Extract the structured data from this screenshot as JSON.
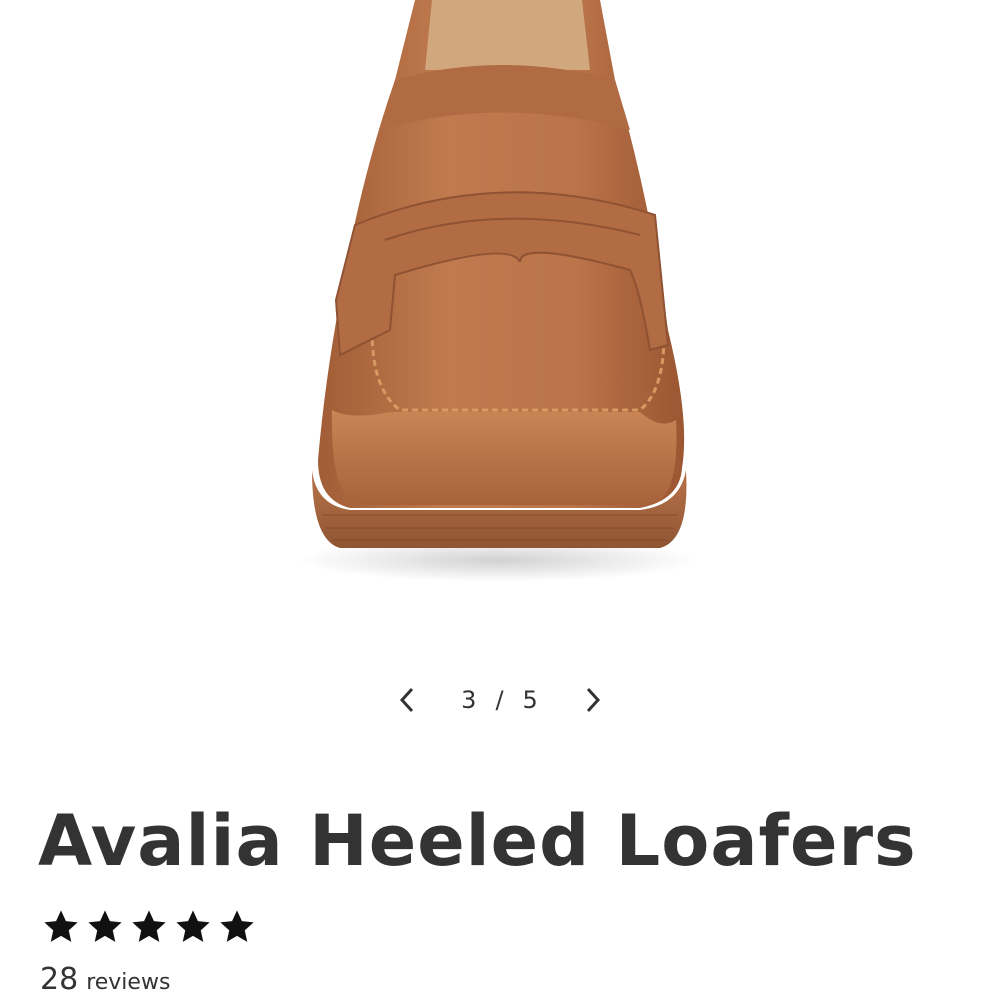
{
  "product": {
    "image_alt": "Avalia Heeled Loafers in cognac brown leather, front view",
    "title": "Avalia Heeled Loafers",
    "rating": 5,
    "rating_max": 5,
    "review_count": "28",
    "review_label": "reviews"
  },
  "gallery": {
    "current": "3",
    "separator": "/",
    "total": "5",
    "prev_icon": "chevron-left-icon",
    "next_icon": "chevron-right-icon"
  },
  "colors": {
    "leather": "#B56E45",
    "text": "#333333",
    "star": "#111111"
  }
}
